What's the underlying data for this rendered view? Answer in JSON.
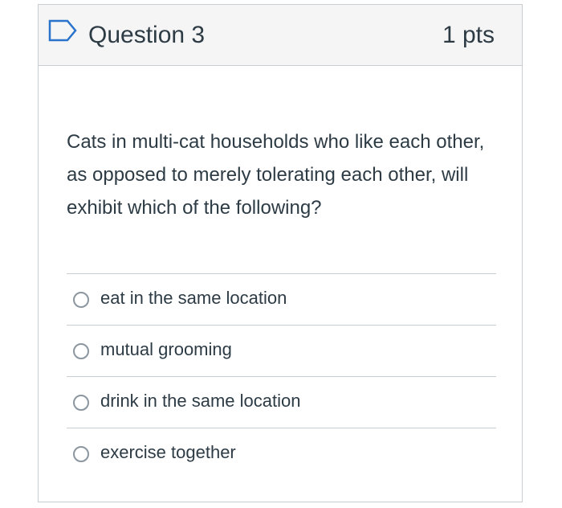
{
  "question": {
    "title": "Question 3",
    "points": "1 pts",
    "flag_icon": "flag-outline-icon",
    "text": "Cats in multi-cat households who like each other, as opposed to merely tolerating each other, will exhibit which of the following?",
    "answers": [
      {
        "label": "eat in the same location",
        "selected": false
      },
      {
        "label": "mutual grooming",
        "selected": false
      },
      {
        "label": "drink in the same location",
        "selected": false
      },
      {
        "label": "exercise together",
        "selected": false
      }
    ]
  },
  "colors": {
    "text": "#2d3b45",
    "border": "#c7cdd1",
    "header_bg": "#f5f5f5",
    "flag": "#2a73cc",
    "radio_border": "#8b969e"
  }
}
